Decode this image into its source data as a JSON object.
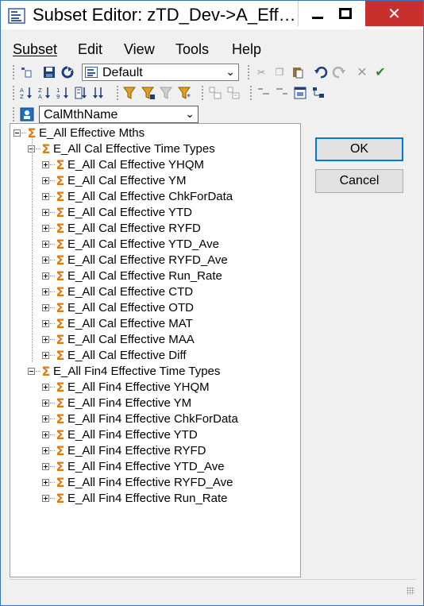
{
  "window": {
    "title": "Subset Editor:  zTD_Dev->A_Eff…",
    "title_icon": "subset-editor-app-icon",
    "controls": {
      "minimize": "minimize-icon",
      "maximize": "maximize-icon",
      "close": "✕"
    }
  },
  "menubar": {
    "items": [
      {
        "label": "Subset",
        "accel": "S"
      },
      {
        "label": "Edit",
        "accel": "E"
      },
      {
        "label": "View",
        "accel": "V"
      },
      {
        "label": "Tools",
        "accel": "T"
      },
      {
        "label": "Help",
        "accel": "H"
      }
    ]
  },
  "toolbar": {
    "subset_dropdown": {
      "value": "Default"
    },
    "dimension_dropdown": {
      "value": "CalMthName"
    }
  },
  "tree": {
    "root": "E_All Effective Mths",
    "groups": [
      {
        "label": "E_All Cal Effective Time Types",
        "children": [
          "E_All Cal Effective YHQM",
          "E_All Cal Effective YM",
          "E_All Cal Effective ChkForData",
          "E_All Cal Effective YTD",
          "E_All Cal Effective RYFD",
          "E_All Cal Effective YTD_Ave",
          "E_All Cal Effective RYFD_Ave",
          "E_All Cal Effective Run_Rate",
          "E_All Cal Effective CTD",
          "E_All Cal Effective OTD",
          "E_All Cal Effective MAT",
          "E_All Cal Effective MAA",
          "E_All Cal Effective Diff"
        ]
      },
      {
        "label": "E_All Fin4 Effective Time Types",
        "children": [
          "E_All Fin4 Effective YHQM",
          "E_All Fin4 Effective YM",
          "E_All Fin4 Effective ChkForData",
          "E_All Fin4 Effective YTD",
          "E_All Fin4 Effective RYFD",
          "E_All Fin4 Effective YTD_Ave",
          "E_All Fin4 Effective RYFD_Ave",
          "E_All Fin4 Effective Run_Rate"
        ]
      }
    ]
  },
  "buttons": {
    "ok": "OK",
    "cancel": "Cancel"
  },
  "colors": {
    "close_button": "#c7302d",
    "sigma": "#e07a10",
    "ok_focus": "#0078d7"
  }
}
